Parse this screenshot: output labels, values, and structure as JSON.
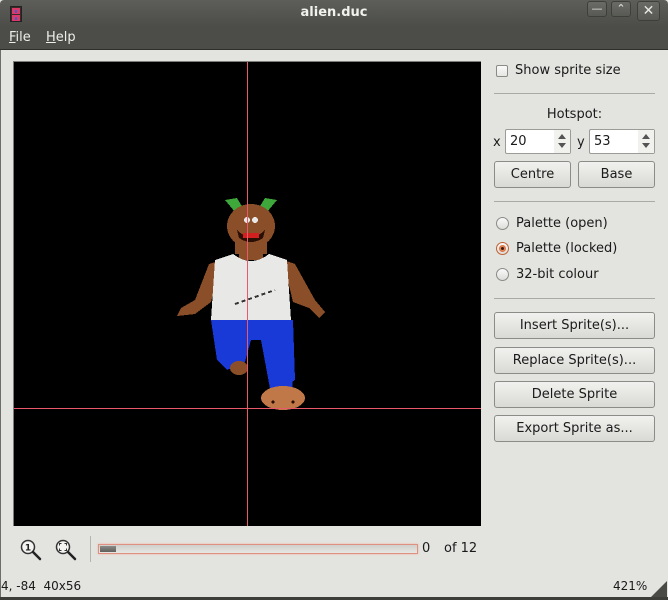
{
  "window": {
    "title": "alien.duc",
    "controls": {
      "minimize": "—",
      "maximize": "^",
      "close": "X"
    },
    "app_icon": "sprite-file-icon"
  },
  "menubar": {
    "items": [
      {
        "label": "File",
        "mnemonic": "F",
        "rest": "ile"
      },
      {
        "label": "Help",
        "mnemonic": "H",
        "rest": "elp"
      }
    ]
  },
  "canvas": {
    "background": "#000000",
    "guide_color": "#e85a6a",
    "sprite": "alien-character"
  },
  "panel": {
    "show_sprite_size": {
      "label": "Show sprite size",
      "checked": false
    },
    "hotspot": {
      "label": "Hotspot:",
      "x_label": "x",
      "x_value": "20",
      "y_label": "y",
      "y_value": "53"
    },
    "centre_label": "Centre",
    "base_label": "Base",
    "colour_modes": [
      {
        "label": "Palette (open)",
        "checked": false
      },
      {
        "label": "Palette (locked)",
        "checked": true
      },
      {
        "label": "32-bit colour",
        "checked": false
      }
    ],
    "actions": {
      "insert": "Insert Sprite(s)...",
      "replace": "Replace Sprite(s)...",
      "delete": "Delete Sprite",
      "export": "Export Sprite as..."
    }
  },
  "toolbar": {
    "zoom_actual_icon": "zoom-1-to-1-icon",
    "zoom_fit_icon": "zoom-fit-icon",
    "frame": {
      "current": "0",
      "of_label": "of 12",
      "total": 12,
      "position_fraction": 0.0
    }
  },
  "statusbar": {
    "left": "4, -84  40x56",
    "coords": "4, -84",
    "size": "40x56",
    "zoom": "421%"
  }
}
